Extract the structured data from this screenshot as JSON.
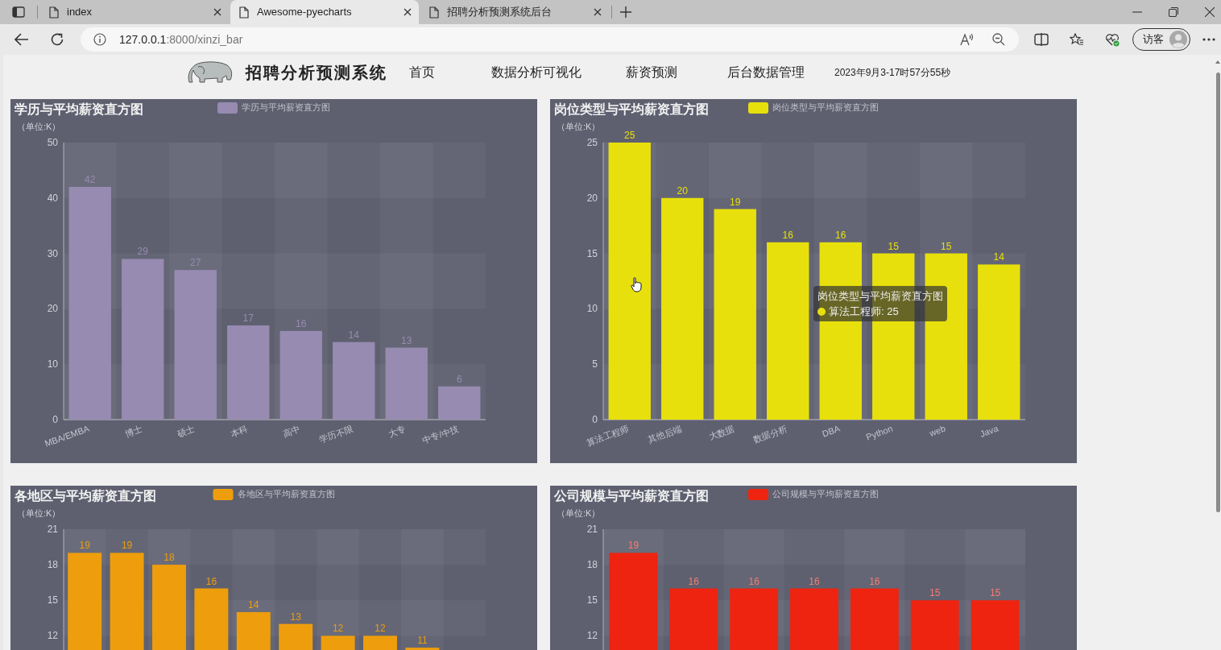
{
  "browser": {
    "tabs": [
      {
        "title": "index",
        "selected": false
      },
      {
        "title": "Awesome-pyecharts",
        "selected": true
      },
      {
        "title": "招聘分析预测系统后台",
        "selected": false
      }
    ],
    "address": {
      "host": "127.0.0.1",
      "rest": ":8000/xinzi_bar"
    },
    "profile": {
      "label": "访客"
    }
  },
  "header": {
    "title": "招聘分析预测系统",
    "nav": [
      {
        "label": "首页"
      },
      {
        "label": "数据分析可视化"
      },
      {
        "label": "薪资预测"
      },
      {
        "label": "后台数据管理"
      }
    ],
    "datetime": "2023年9月3-17时57分55秒"
  },
  "charts": [
    {
      "chart_data": {
        "type": "bar",
        "title": "学历与平均薪资直方图",
        "ylabel": "（单位:K）",
        "categories": [
          "MBA/EMBA",
          "博士",
          "硕士",
          "本科",
          "高中",
          "学历不限",
          "大专",
          "中专/中技"
        ],
        "series": [
          {
            "name": "学历与平均薪资直方图",
            "color": "#978bb1",
            "values": [
              42,
              29,
              27,
              17,
              16,
              14,
              13,
              6
            ]
          }
        ],
        "ylim": [
          0,
          50
        ],
        "yticks": [
          0,
          10,
          20,
          30,
          40,
          50
        ],
        "data_labels": true
      }
    },
    {
      "chart_data": {
        "type": "bar",
        "title": "岗位类型与平均薪资直方图",
        "ylabel": "（单位:K）",
        "categories": [
          "算法工程师",
          "其他后端",
          "大数据",
          "数据分析",
          "DBA",
          "Python",
          "web",
          "Java"
        ],
        "series": [
          {
            "name": "岗位类型与平均薪资直方图",
            "color": "#e8e00c",
            "values": [
              25,
              20,
              19,
              16,
              16,
              15,
              15,
              14
            ]
          }
        ],
        "ylim": [
          0,
          25
        ],
        "yticks": [
          0,
          5,
          10,
          15,
          20,
          25
        ],
        "data_labels": true
      },
      "tooltip": {
        "title": "岗位类型与平均薪资直方图",
        "text": "算法工程师: 25"
      }
    },
    {
      "chart_data": {
        "type": "bar",
        "title": "各地区与平均薪资直方图",
        "ylabel": "（单位:K）",
        "categories": [
          null,
          null,
          null,
          null,
          null,
          null,
          null,
          null,
          null
        ],
        "series": [
          {
            "name": "各地区与平均薪资直方图",
            "color": "#ee9e0c",
            "values": [
              19,
              19,
              18,
              16,
              14,
              13,
              12,
              12,
              11
            ]
          }
        ],
        "ylim": [
          10.8,
          21
        ],
        "yticks": [
          12,
          15,
          18,
          21
        ],
        "data_labels": true
      }
    },
    {
      "chart_data": {
        "type": "bar",
        "title": "公司规模与平均薪资直方图",
        "ylabel": "（单位:K）",
        "categories": [
          null,
          null,
          null,
          null,
          null,
          null,
          null
        ],
        "series": [
          {
            "name": "公司规模与平均薪资直方图",
            "color": "#ee2410",
            "values": [
              19,
              16,
              16,
              16,
              16,
              15,
              15
            ]
          }
        ],
        "ylim": [
          10.8,
          21
        ],
        "yticks": [
          12,
          15,
          18,
          21
        ],
        "data_labels": true
      }
    }
  ]
}
